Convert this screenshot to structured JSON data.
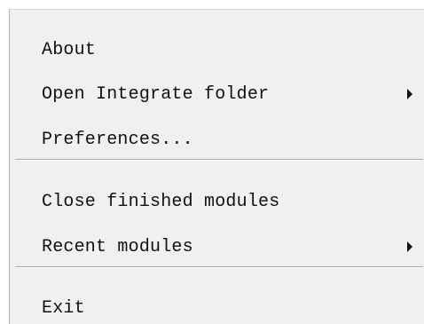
{
  "menu": {
    "items": [
      {
        "label": "About",
        "submenu": false
      },
      {
        "label": "Open Integrate folder",
        "submenu": true
      },
      {
        "label": "Preferences...",
        "submenu": false
      },
      {
        "label": "Close finished modules",
        "submenu": false
      },
      {
        "label": "Recent modules",
        "submenu": true
      },
      {
        "label": "Exit",
        "submenu": false
      }
    ]
  },
  "colors": {
    "menu_background": "#f0f0f0",
    "text": "#111111",
    "separator": "#a8a8a8"
  }
}
